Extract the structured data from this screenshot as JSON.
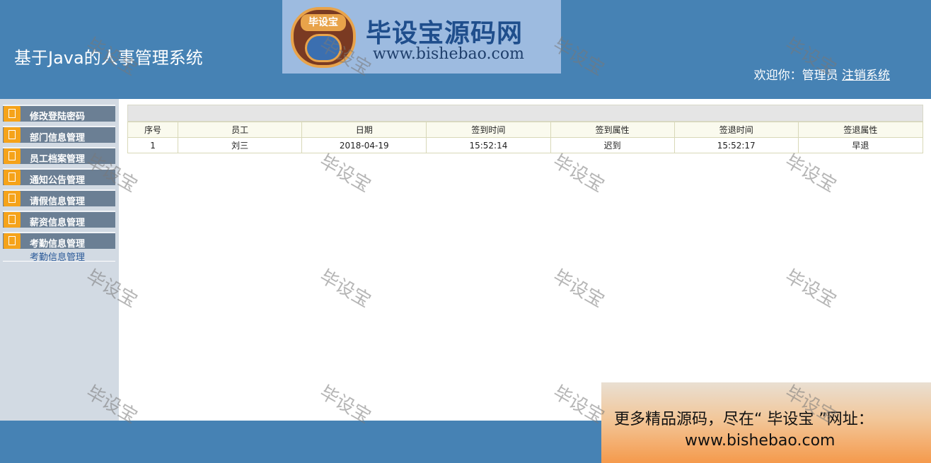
{
  "header": {
    "app_title": "基于Java的人事管理系统",
    "welcome": "欢迎你：管理员",
    "logout": "注销系统"
  },
  "logo": {
    "badge_text": "毕设宝",
    "name": "毕设宝源码网",
    "url": "www.bishebao.com"
  },
  "sidebar": {
    "items": [
      {
        "label": "修改登陆密码",
        "icon": "document-icon"
      },
      {
        "label": "部门信息管理",
        "icon": "document-icon"
      },
      {
        "label": "员工档案管理",
        "icon": "document-icon"
      },
      {
        "label": "通知公告管理",
        "icon": "document-icon"
      },
      {
        "label": "请假信息管理",
        "icon": "document-icon"
      },
      {
        "label": "薪资信息管理",
        "icon": "document-icon"
      },
      {
        "label": "考勤信息管理",
        "icon": "document-icon"
      }
    ],
    "active_submenu": "考勤信息管理"
  },
  "table": {
    "columns": [
      "序号",
      "员工",
      "日期",
      "签到时间",
      "签到属性",
      "签退时间",
      "签退属性"
    ],
    "rows": [
      [
        "1",
        "刘三",
        "2018-04-19",
        "15:52:14",
        "迟到",
        "15:52:17",
        "早退"
      ]
    ]
  },
  "ad": {
    "line1": "更多精品源码，尽在“ 毕设宝 ”网址：",
    "line2": "www.bishebao.com"
  },
  "watermark": "毕设宝",
  "colors": {
    "header_bg": "#4682b4",
    "sidebar_bg": "#d2dae3",
    "menu_bg": "#6b7f94",
    "menu_icon": "#f5a31a"
  }
}
